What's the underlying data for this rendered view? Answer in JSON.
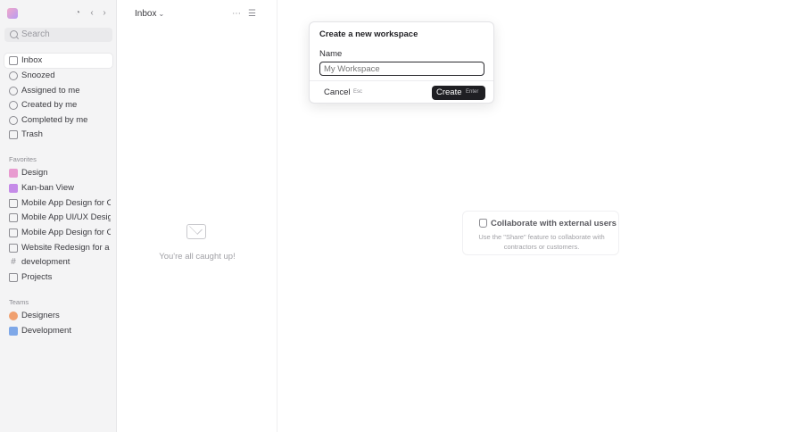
{
  "sidebar": {
    "search_placeholder": "Search",
    "nav": [
      {
        "label": "Inbox",
        "icon": "inbox-icon",
        "active": true
      },
      {
        "label": "Snoozed",
        "icon": "clock-icon"
      },
      {
        "label": "Assigned to me",
        "icon": "user-circle-icon"
      },
      {
        "label": "Created by me",
        "icon": "user-icon"
      },
      {
        "label": "Completed by me",
        "icon": "check-circle-icon"
      },
      {
        "label": "Trash",
        "icon": "trash-icon"
      }
    ],
    "favorites_label": "Favorites",
    "favorites": [
      {
        "label": "Design",
        "icon": "grid-icon",
        "color": "#e89bd0"
      },
      {
        "label": "Kan-ban View",
        "icon": "board-icon",
        "color": "#c58be8"
      },
      {
        "label": "Mobile App Design for Online Store",
        "icon": "folder-icon"
      },
      {
        "label": "Mobile App UI/UX Design",
        "icon": "square-icon"
      },
      {
        "label": "Mobile App Design for Online Store",
        "icon": "folder-icon"
      },
      {
        "label": "Website Redesign for a Client",
        "icon": "folder-icon"
      },
      {
        "label": "development",
        "icon": "hash-icon"
      },
      {
        "label": "Projects",
        "icon": "folder-icon"
      }
    ],
    "teams_label": "Teams",
    "teams": [
      {
        "label": "Designers",
        "icon": "team-icon",
        "color": "#f0a070"
      },
      {
        "label": "Development",
        "icon": "team-icon",
        "color": "#7fa8e8"
      }
    ]
  },
  "inbox": {
    "title": "Inbox",
    "empty_text": "You're all caught up!"
  },
  "modal": {
    "title": "Create a new workspace",
    "name_label": "Name",
    "name_placeholder": "My Workspace",
    "cancel_label": "Cancel",
    "cancel_shortcut": "Esc",
    "create_label": "Create",
    "create_shortcut": "Enter"
  },
  "collab": {
    "title": "Collaborate with external users",
    "description": "Use the \"Share\" feature to collaborate with contractors or customers."
  }
}
